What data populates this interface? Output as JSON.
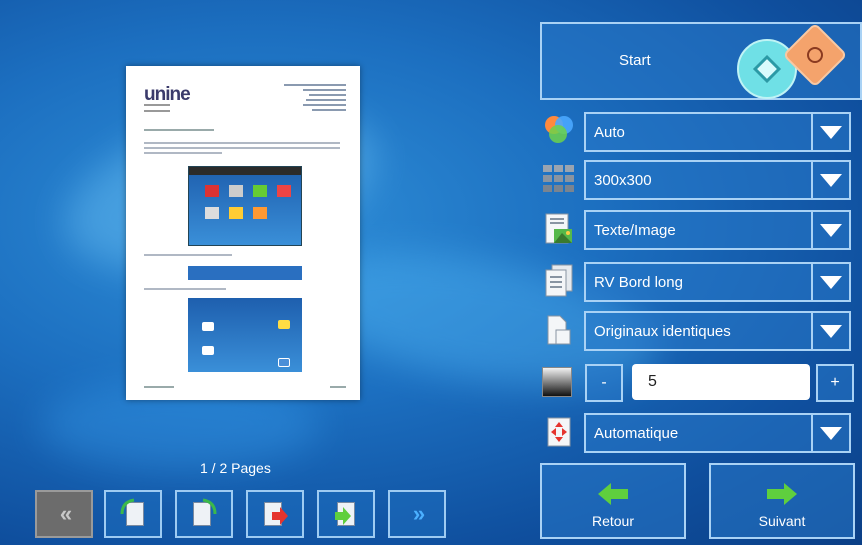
{
  "preview": {
    "pages_label": "1 / 2 Pages",
    "logo_text": "unine"
  },
  "nav": {
    "first_icon": "double-chevron-left-icon",
    "last_icon": "double-chevron-right-icon",
    "first_label": "«",
    "last_label": "»"
  },
  "start": {
    "label": "Start",
    "start_icon": "start-diamond-icon",
    "stop_icon": "stop-icon"
  },
  "settings": {
    "color_mode": "Auto",
    "resolution": "300x300",
    "original_type": "Texte/Image",
    "duplex": "RV Bord long",
    "originals": "Originaux identiques",
    "density_minus": "-",
    "density_plus": "+",
    "density_value": "5",
    "orientation": "Automatique"
  },
  "footer": {
    "back_label": "Retour",
    "next_label": "Suivant"
  },
  "colors": {
    "accent_green": "#5fcf3e",
    "start_cyan": "#6fe0e6",
    "stop_orange": "#f4a36c"
  }
}
